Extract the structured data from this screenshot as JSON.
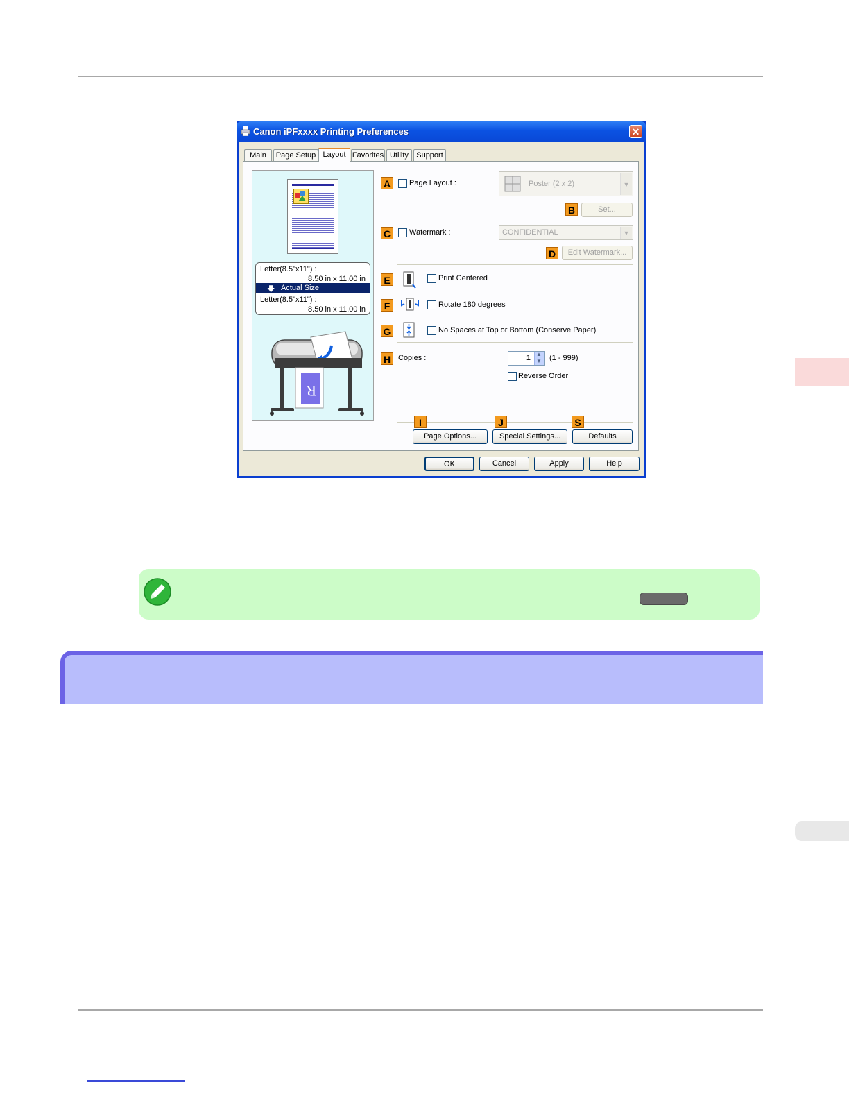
{
  "dialog": {
    "title": "Canon iPFxxxx Printing Preferences",
    "close_glyph": "✕",
    "tabs": [
      {
        "label": "Main"
      },
      {
        "label": "Page Setup"
      },
      {
        "label": "Layout"
      },
      {
        "label": "Favorites"
      },
      {
        "label": "Utility"
      },
      {
        "label": "Support"
      }
    ],
    "active_tab": "Layout",
    "preview": {
      "size_line1_left": "Letter(8.5\"x11\") :",
      "size_line1_right": "8.50 in x 11.00 in",
      "selected": "Actual Size",
      "size_line2_left": "Letter(8.5\"x11\") :",
      "size_line2_right": "8.50 in x 11.00 in",
      "arrow_glyph": "🡇"
    },
    "options": {
      "A": {
        "badge": "A",
        "label": "Page Layout :",
        "value": "Poster (2 x 2)",
        "checked": false
      },
      "B": {
        "badge": "B",
        "button": "Set..."
      },
      "C": {
        "badge": "C",
        "label": "Watermark :",
        "value": "CONFIDENTIAL",
        "checked": false
      },
      "D": {
        "badge": "D",
        "button": "Edit Watermark..."
      },
      "E": {
        "badge": "E",
        "label": "Print Centered",
        "checked": false
      },
      "F": {
        "badge": "F",
        "label": "Rotate 180 degrees",
        "checked": false
      },
      "G": {
        "badge": "G",
        "label": "No Spaces at Top or Bottom (Conserve Paper)",
        "checked": false
      },
      "H": {
        "badge": "H",
        "label": "Copies :",
        "value": "1",
        "range": "(1 - 999)"
      },
      "reverse": {
        "label": "Reverse Order",
        "checked": false
      },
      "I": {
        "badge": "I",
        "button": "Page Options..."
      },
      "J": {
        "badge": "J",
        "button": "Special Settings..."
      },
      "S": {
        "badge": "S",
        "button": "Defaults"
      }
    },
    "footer": {
      "ok": "OK",
      "cancel": "Cancel",
      "apply": "Apply",
      "help": "Help"
    }
  },
  "colors": {
    "badge": "#f39a1e",
    "title_bar": "#0b52e2",
    "note_bg": "#ccfcc8",
    "band_bg": "#b8bdfc",
    "band_border": "#6c63e6",
    "side_tab": "#fadada"
  },
  "icons": {
    "note": "pencil-note-icon",
    "app": "printer-icon",
    "close": "close-icon"
  }
}
